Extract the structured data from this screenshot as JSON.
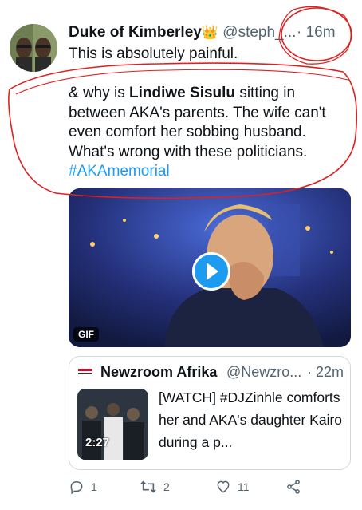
{
  "tweet": {
    "author_name": "Duke of Kimberley",
    "author_emoji": "👑",
    "handle": "@steph_...",
    "time": "· 16m",
    "line1": "This is absolutely painful.",
    "body": {
      "prefix": "& why is ",
      "bold_name": "Lindiwe Sisulu",
      "suffix": " sitting in between AKA's parents. The wife can't even comfort her sobbing husband. What's wrong with these politicians.",
      "hashtag": "#AKAmemorial"
    },
    "media_badge": "GIF"
  },
  "quote": {
    "name": "Newzroom Afrika",
    "handle": "@Newzro...",
    "time": "· 22m",
    "duration": "2:27",
    "text": "[WATCH] #DJZinhle comforts her and AKA's daughter Kairo during a p..."
  },
  "actions": {
    "reply_count": "1",
    "retweet_count": "2",
    "like_count": "11"
  },
  "colors": {
    "link": "#1d9bf0",
    "muted": "#536471",
    "annotation": "#e02020"
  }
}
